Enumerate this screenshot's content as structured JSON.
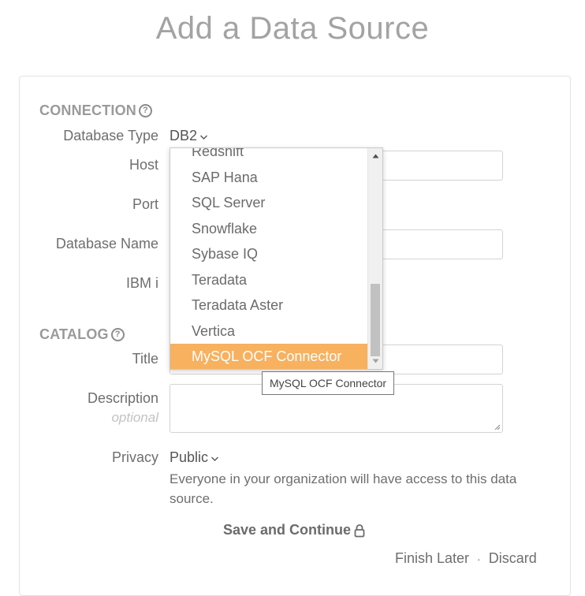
{
  "page": {
    "title": "Add a Data Source"
  },
  "connection": {
    "heading": "CONNECTION",
    "database_type_label": "Database Type",
    "database_type_value": "DB2",
    "host_label": "Host",
    "port_label": "Port",
    "database_name_label": "Database Name",
    "ibm_label": "IBM i"
  },
  "dropdown": {
    "items": [
      "Redshift",
      "SAP Hana",
      "SQL Server",
      "Snowflake",
      "Sybase IQ",
      "Teradata",
      "Teradata Aster",
      "Vertica",
      "MySQL OCF Connector"
    ],
    "selected_index": 8,
    "tooltip": "MySQL OCF Connector"
  },
  "catalog": {
    "heading": "CATALOG",
    "title_label": "Title",
    "description_label": "Description",
    "description_sublabel": "optional",
    "privacy_label": "Privacy",
    "privacy_value": "Public",
    "privacy_help": "Everyone in your organization will have access to this data source."
  },
  "actions": {
    "save_label": "Save and Continue",
    "finish_later_label": "Finish Later",
    "separator": "·",
    "discard_label": "Discard"
  },
  "colors": {
    "accent_selected": "#f7b15f",
    "title_gray": "#a3a3a3"
  }
}
